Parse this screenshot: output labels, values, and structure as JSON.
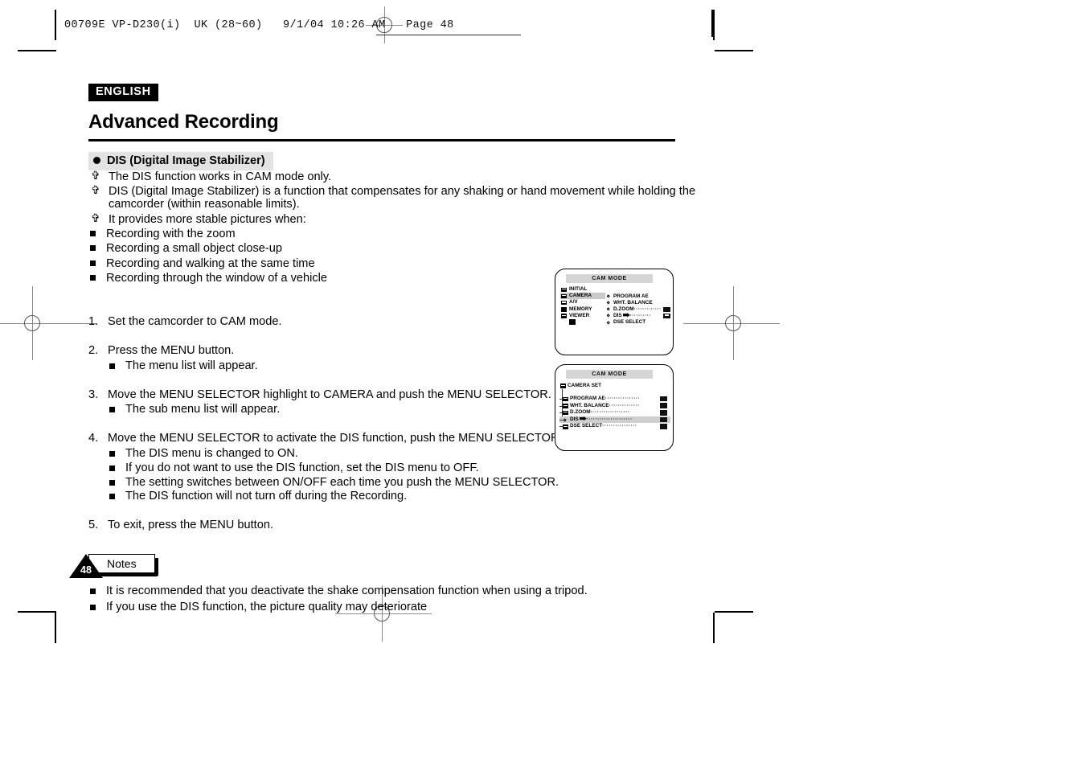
{
  "print_slug": "00709E VP-D230(i)  UK (28~60)   9/1/04 10:26 AM   Page 48",
  "header": {
    "language_badge": "ENGLISH",
    "title": "Advanced Recording"
  },
  "section": {
    "bullet_icon": "filled-circle-icon",
    "heading": "DIS (Digital Image Stabilizer)"
  },
  "intro_bullets": [
    "The DIS function works in CAM mode only.",
    "DIS (Digital Image Stabilizer) is a function that compensates for any shaking or hand movement while holding the camcorder (within reasonable limits).",
    "It provides more stable pictures when:"
  ],
  "sub_bullets": [
    "Recording with the zoom",
    "Recording a small object close-up",
    "Recording and walking at the same time",
    "Recording through the window of a vehicle"
  ],
  "steps": [
    {
      "number": "1.",
      "text": "Set the camcorder to CAM mode.",
      "sub": []
    },
    {
      "number": "2.",
      "text": "Press the MENU button.",
      "sub": [
        "The menu list will appear."
      ]
    },
    {
      "number": "3.",
      "text": "Move the MENU SELECTOR highlight to CAMERA and push the MENU SELECTOR.",
      "sub": [
        "The sub menu list will appear."
      ]
    },
    {
      "number": "4.",
      "text": "Move the MENU SELECTOR to activate the DIS function, push the MENU SELECTOR.",
      "sub": [
        "The DIS menu is changed to ON.",
        "If you do not want to use the DIS function, set the DIS menu to OFF.",
        "The setting switches between ON/OFF each time you push the MENU SELECTOR.",
        "The DIS function will not turn off during the Recording."
      ]
    },
    {
      "number": "5.",
      "text": "To exit, press the MENU button.",
      "sub": []
    }
  ],
  "notes": {
    "label": "Notes",
    "items": [
      "It is recommended that you deactivate the shake compensation function when using a tripod.",
      "If you use the DIS function, the picture quality may deteriorate"
    ]
  },
  "page_number": "48",
  "lcd_screen_1": {
    "title": "CAM MODE",
    "left_menu": [
      {
        "label": "INITIAL",
        "icon": "folder-icon",
        "selected": false
      },
      {
        "label": "CAMERA",
        "icon": "folder-icon",
        "selected": true
      },
      {
        "label": "A/V",
        "icon": "folder-icon",
        "selected": false
      },
      {
        "label": "MEMORY",
        "icon": "block-icon",
        "selected": false
      },
      {
        "label": "VIEWER",
        "icon": "folder-icon",
        "selected": false
      }
    ],
    "right_menu": [
      {
        "label": "PROGRAM AE",
        "icon": "diamond-icon",
        "dots": "",
        "value_icon": ""
      },
      {
        "label": "WHT. BALANCE",
        "icon": "diamond-icon",
        "dots": "",
        "value_icon": ""
      },
      {
        "label": "D.ZOOM",
        "icon": "diamond-icon",
        "dots": "·············",
        "value_icon": "value-box-icon"
      },
      {
        "label": "DIS",
        "icon": "diamond-icon",
        "dots": "··········",
        "value_icon": "value-box-split-icon",
        "cursor": "arrow-cursor-icon"
      },
      {
        "label": "DSE SELECT",
        "icon": "diamond-icon",
        "dots": "",
        "value_icon": ""
      }
    ]
  },
  "lcd_screen_2": {
    "title": "CAM MODE",
    "group_label": "CAMERA SET",
    "items": [
      {
        "label": "PROGRAM AE",
        "icon": "folder-icon",
        "dots": "················",
        "value_icon": "value-box-icon",
        "selected": false
      },
      {
        "label": "WHT. BALANCE",
        "icon": "folder-icon",
        "dots": "··············",
        "value_icon": "value-box-icon",
        "selected": false
      },
      {
        "label": "D.ZOOM",
        "icon": "folder-icon",
        "dots": "··················",
        "value_icon": "value-box-icon",
        "selected": false
      },
      {
        "label": "DIS",
        "icon": "diamond-icon",
        "dots": "·····················",
        "value_icon": "value-box-icon",
        "selected": true,
        "cursor": "arrow-cursor-icon"
      },
      {
        "label": "DSE SELECT",
        "icon": "folder-icon",
        "dots": "················",
        "value_icon": "value-box-icon",
        "selected": false
      }
    ]
  }
}
